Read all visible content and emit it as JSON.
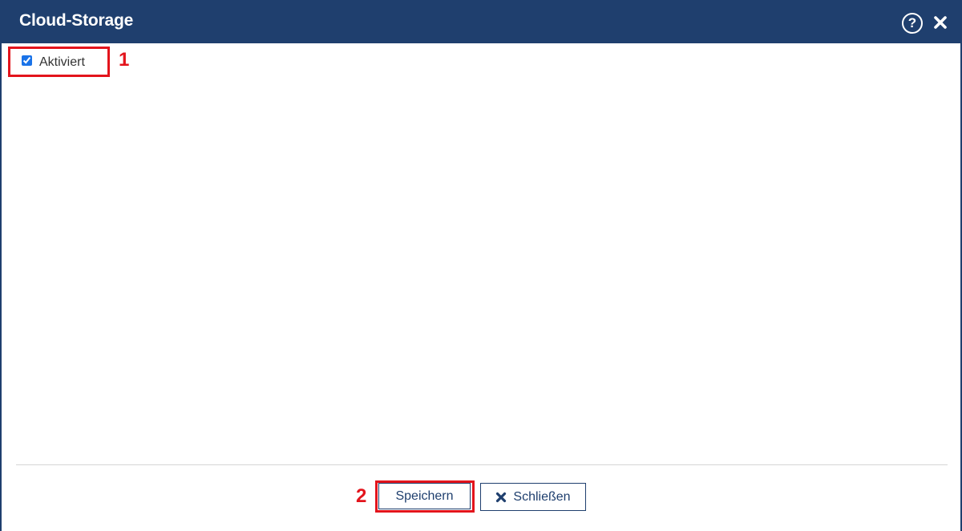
{
  "dialog": {
    "title": "Cloud-Storage",
    "help_icon": "question-circle-icon",
    "help_glyph": "?",
    "close_icon": "close-icon"
  },
  "form": {
    "enabled_label": "Aktiviert",
    "enabled_checked": true
  },
  "annotations": {
    "marker_1": "1",
    "marker_2": "2"
  },
  "footer": {
    "save_label": "Speichern",
    "close_label": "Schließen",
    "close_icon": "times-icon"
  },
  "colors": {
    "header_bg": "#1f3f6e",
    "annotation_red": "#e3141c",
    "button_text": "#1f3f6e"
  }
}
